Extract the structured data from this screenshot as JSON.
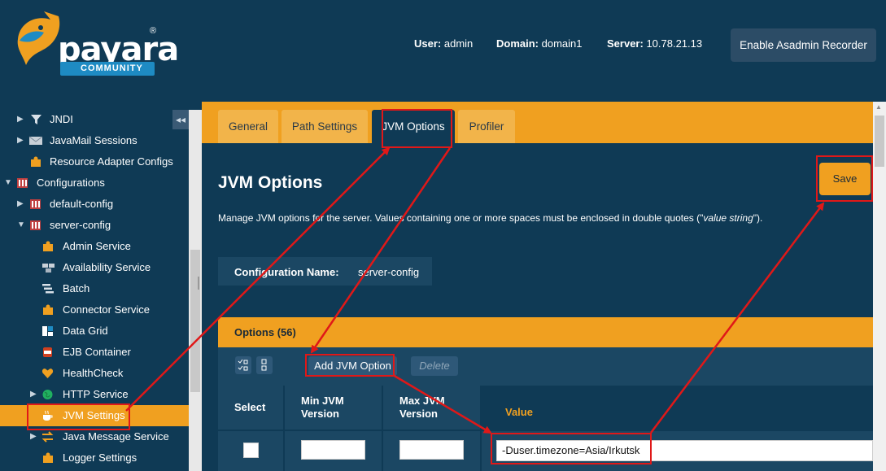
{
  "brand": {
    "name": "payara",
    "reg": "®",
    "badge": "COMMUNITY"
  },
  "header": {
    "user_label": "User:",
    "user_value": "admin",
    "domain_label": "Domain:",
    "domain_value": "domain1",
    "server_label": "Server:",
    "server_value": "10.78.21.13",
    "asadmin_button": "Enable Asadmin Recorder"
  },
  "sidebar": {
    "collapse_glyph": "◂◂",
    "items": [
      {
        "label": "JNDI",
        "icon": "filter-icon",
        "arrow": "▶"
      },
      {
        "label": "JavaMail Sessions",
        "icon": "mail-icon",
        "arrow": "▶"
      },
      {
        "label": "Resource Adapter Configs",
        "icon": "puzzle-icon",
        "arrow": ""
      },
      {
        "label": "Configurations",
        "icon": "config-icon",
        "arrow": "▼"
      },
      {
        "label": "default-config",
        "icon": "config-icon",
        "arrow": "▶"
      },
      {
        "label": "server-config",
        "icon": "config-icon",
        "arrow": "▼"
      },
      {
        "label": "Admin Service",
        "icon": "puzzle-icon",
        "arrow": ""
      },
      {
        "label": "Availability Service",
        "icon": "availability-icon",
        "arrow": ""
      },
      {
        "label": "Batch",
        "icon": "batch-icon",
        "arrow": ""
      },
      {
        "label": "Connector Service",
        "icon": "puzzle-icon",
        "arrow": ""
      },
      {
        "label": "Data Grid",
        "icon": "data-grid-icon",
        "arrow": ""
      },
      {
        "label": "EJB Container",
        "icon": "jar-icon",
        "arrow": ""
      },
      {
        "label": "HealthCheck",
        "icon": "heart-icon",
        "arrow": ""
      },
      {
        "label": "HTTP Service",
        "icon": "globe-icon",
        "arrow": "▶"
      },
      {
        "label": "JVM Settings",
        "icon": "coffee-icon",
        "arrow": ""
      },
      {
        "label": "Java Message Service",
        "icon": "exchange-icon",
        "arrow": "▶"
      },
      {
        "label": "Logger Settings",
        "icon": "puzzle-icon",
        "arrow": ""
      }
    ]
  },
  "tabs": [
    {
      "label": "General"
    },
    {
      "label": "Path Settings"
    },
    {
      "label": "JVM Options"
    },
    {
      "label": "Profiler"
    }
  ],
  "page": {
    "title": "JVM Options",
    "desc_main": "Manage JVM options for the server. Values containing one or more spaces must be enclosed in double quotes (\"",
    "desc_italic": "value string",
    "desc_end": "\").",
    "save_button": "Save",
    "config_label": "Configuration Name:",
    "config_value": "server-config"
  },
  "options": {
    "title": "Options (56)",
    "add_button": "Add JVM Option",
    "delete_button": "Delete",
    "columns": {
      "select": "Select",
      "min_version": [
        "Min JVM",
        "Version"
      ],
      "max_version": [
        "Max JVM",
        "Version"
      ],
      "value": "Value"
    },
    "rows": [
      {
        "selected": false,
        "min": "",
        "max": "",
        "value": "-Duser.timezone=Asia/Irkutsk"
      }
    ]
  },
  "colors": {
    "accent": "#f0a020",
    "background": "#0f3a55",
    "panel": "#1b4763",
    "highlight": "#e01818"
  }
}
